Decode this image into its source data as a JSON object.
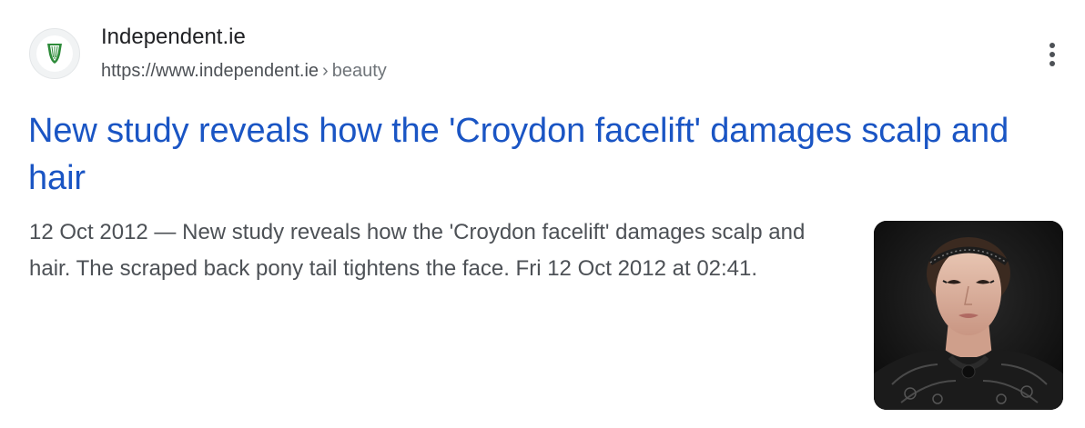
{
  "result": {
    "site_name": "Independent.ie",
    "url": "https://www.independent.ie",
    "breadcrumb_separator": "›",
    "breadcrumb": "beauty",
    "favicon": "harp-icon",
    "title": "New study reveals how the 'Croydon facelift' damages scalp and hair",
    "date": "12 Oct 2012",
    "date_separator": " — ",
    "snippet": "New study reveals how the 'Croydon facelift' damages scalp and hair. The scraped back pony tail tightens the face. Fri 12 Oct 2012 at 02:41.",
    "more_icon": "more-vert-icon",
    "thumbnail": "photo of a woman with slicked-back hair wearing a dark lace outfit"
  },
  "colors": {
    "title_link": "#1a55c4",
    "site_name": "#202124",
    "url_text": "#4d5156",
    "snippet_text": "#4d5156",
    "favicon_green": "#2e8b3a"
  }
}
